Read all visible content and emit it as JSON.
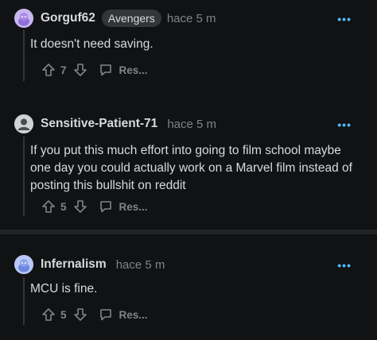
{
  "comments": [
    {
      "username": "Gorguf62",
      "flair": "Avengers",
      "time": "hace 5 m",
      "text": "It doesn't need saving.",
      "score": "7",
      "reply_label": "Res...",
      "more_label": "•••",
      "avatar_icon": "purple-snoo-avatar-icon"
    },
    {
      "username": "Sensitive-Patient-71",
      "time": "hace 5 m",
      "text": "If you put this much effort into going to film school maybe one day you could actually work on a Marvel film instead of posting this bullshit on reddit",
      "score": "5",
      "reply_label": "Res...",
      "more_label": "•••",
      "avatar_icon": "default-user-avatar-icon"
    },
    {
      "username": "Infernalism",
      "time": "hace 5 m",
      "text": "MCU is fine.",
      "score": "5",
      "reply_label": "Res...",
      "more_label": "•••",
      "avatar_icon": "blue-snoo-avatar-icon"
    }
  ],
  "colors": {
    "background": "#111213",
    "text": "#d7dadc",
    "muted": "#818384",
    "accent": "#4fbcff",
    "flair_bg": "#343536"
  }
}
